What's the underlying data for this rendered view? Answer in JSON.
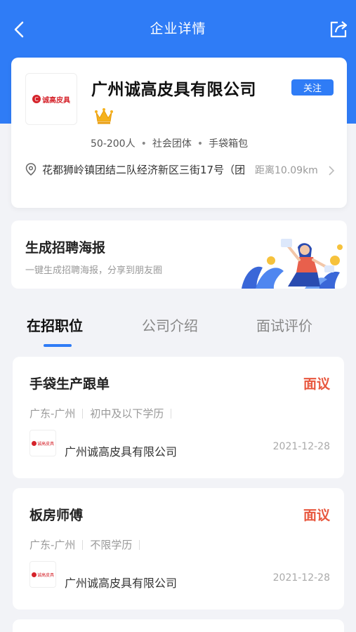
{
  "header": {
    "title": "企业详情",
    "back_icon": "back-arrow-icon",
    "share_icon": "share-icon"
  },
  "company": {
    "logo_text": "诚高皮具",
    "name": "广州诚高皮具有限公司",
    "follow_label": "关注",
    "crown_icon": "crown-icon",
    "size": "50-200人",
    "type": "社会团体",
    "industry": "手袋箱包",
    "separator": "•",
    "address": "花都狮岭镇团结二队经济新区三街17号（团",
    "distance": "距离10.09km"
  },
  "poster": {
    "title": "生成招聘海报",
    "subtitle": "一键生成招聘海报，分享到朋友圈"
  },
  "tabs": [
    {
      "label": "在招职位",
      "active": true
    },
    {
      "label": "公司介绍",
      "active": false
    },
    {
      "label": "面试评价",
      "active": false
    }
  ],
  "jobs": [
    {
      "title": "手袋生产跟单",
      "salary": "面议",
      "location": "广东-广州",
      "education": "初中及以下学历",
      "company": "广州诚高皮具有限公司",
      "date": "2021-12-28"
    },
    {
      "title": "板房师傅",
      "salary": "面议",
      "location": "广东-广州",
      "education": "不限学历",
      "company": "广州诚高皮具有限公司",
      "date": "2021-12-28"
    }
  ],
  "colors": {
    "primary": "#2f7cf6",
    "salary": "#e8573e",
    "logo_red": "#d5232b"
  }
}
